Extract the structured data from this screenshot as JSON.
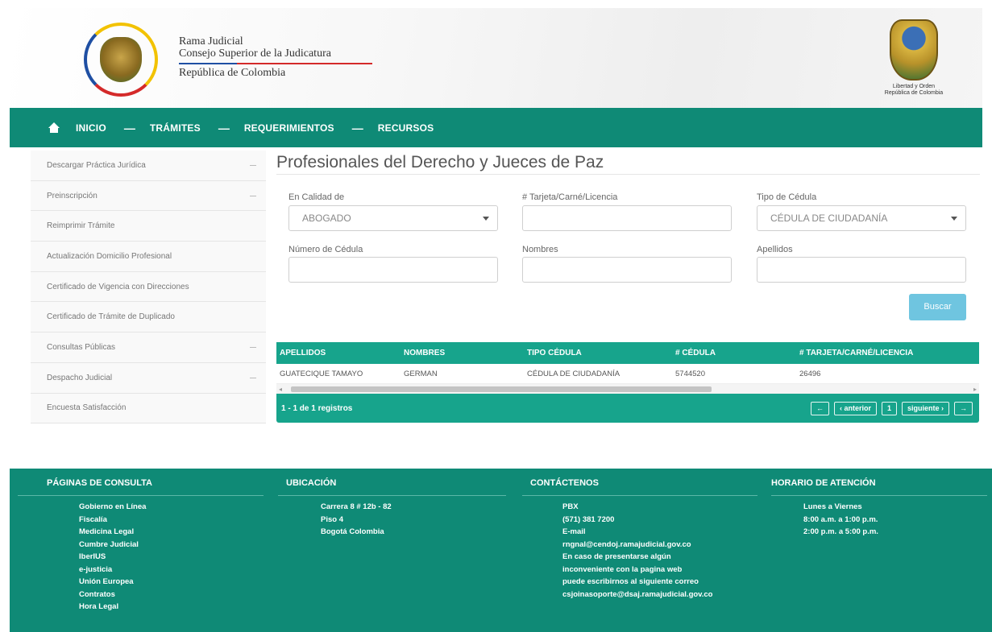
{
  "header": {
    "brand_line1": "Rama Judicial",
    "brand_line2": "Consejo Superior de la Judicatura",
    "brand_line3": "República de Colombia",
    "shield_caption1": "Libertad y Orden",
    "shield_caption2": "República de Colombia"
  },
  "nav": {
    "items": [
      "INICIO",
      "TRÁMITES",
      "REQUERIMIENTOS",
      "RECURSOS"
    ]
  },
  "sidebar": {
    "items": [
      {
        "label": "Descargar Práctica Jurídica",
        "expandable": true
      },
      {
        "label": "Preinscripción",
        "expandable": true
      },
      {
        "label": "Reimprimir Trámite",
        "expandable": false
      },
      {
        "label": "Actualización Domicilio Profesional",
        "expandable": false
      },
      {
        "label": "Certificado de Vigencia con Direcciones",
        "expandable": false
      },
      {
        "label": "Certificado de Trámite de Duplicado",
        "expandable": false
      },
      {
        "label": "Consultas Públicas",
        "expandable": true
      },
      {
        "label": "Despacho Judicial",
        "expandable": true
      },
      {
        "label": "Encuesta Satisfacción",
        "expandable": false
      }
    ]
  },
  "main": {
    "title": "Profesionales del Derecho y Jueces de Paz",
    "form": {
      "calidad_label": "En Calidad de",
      "calidad_value": "ABOGADO",
      "tarjeta_label": "# Tarjeta/Carné/Licencia",
      "tarjeta_value": "",
      "tipo_cedula_label": "Tipo de Cédula",
      "tipo_cedula_value": "CÉDULA DE CIUDADANÍA",
      "numero_cedula_label": "Número de Cédula",
      "numero_cedula_value": "",
      "nombres_label": "Nombres",
      "nombres_value": "",
      "apellidos_label": "Apellidos",
      "apellidos_value": "",
      "search_button": "Buscar"
    },
    "table": {
      "headers": [
        "APELLIDOS",
        "NOMBRES",
        "TIPO CÉDULA",
        "# CÉDULA",
        "# TARJETA/CARNÉ/LICENCIA"
      ],
      "rows": [
        [
          "GUATECIQUE TAMAYO",
          "GERMAN",
          "CÉDULA DE CIUDADANÍA",
          "5744520",
          "26496"
        ]
      ],
      "scroll_left": "◂",
      "scroll_right": "▸",
      "footer_info": "1 - 1 de 1 registros",
      "pager": {
        "first": "←",
        "prev": "‹ anterior",
        "page": "1",
        "next": "siguiente ›",
        "last": "→"
      }
    }
  },
  "footer": {
    "col1": {
      "title": "PÁGINAS DE CONSULTA",
      "lines": [
        "Gobierno en Línea",
        "Fiscalía",
        "Medicina Legal",
        "Cumbre Judicial",
        "IberIUS",
        "e-justicia",
        "Unión Europea",
        "Contratos",
        "Hora Legal"
      ]
    },
    "col2": {
      "title": "UBICACIÓN",
      "lines": [
        "Carrera 8 # 12b - 82",
        "Piso 4",
        "Bogotá Colombia"
      ]
    },
    "col3": {
      "title": "CONTÁCTENOS",
      "lines": [
        "PBX",
        "(571) 381 7200",
        "E-mail",
        "rngnal@cendoj.ramajudicial.gov.co",
        "En caso de presentarse algún",
        "inconveniente con la pagina web",
        "puede escribirnos al siguiente correo",
        "csjoinasoporte@dsaj.ramajudicial.gov.co"
      ]
    },
    "col4": {
      "title": "HORARIO DE ATENCIÓN",
      "lines": [
        "Lunes a Viernes",
        "8:00 a.m. a 1:00 p.m.",
        "2:00 p.m. a 5:00 p.m."
      ]
    }
  }
}
